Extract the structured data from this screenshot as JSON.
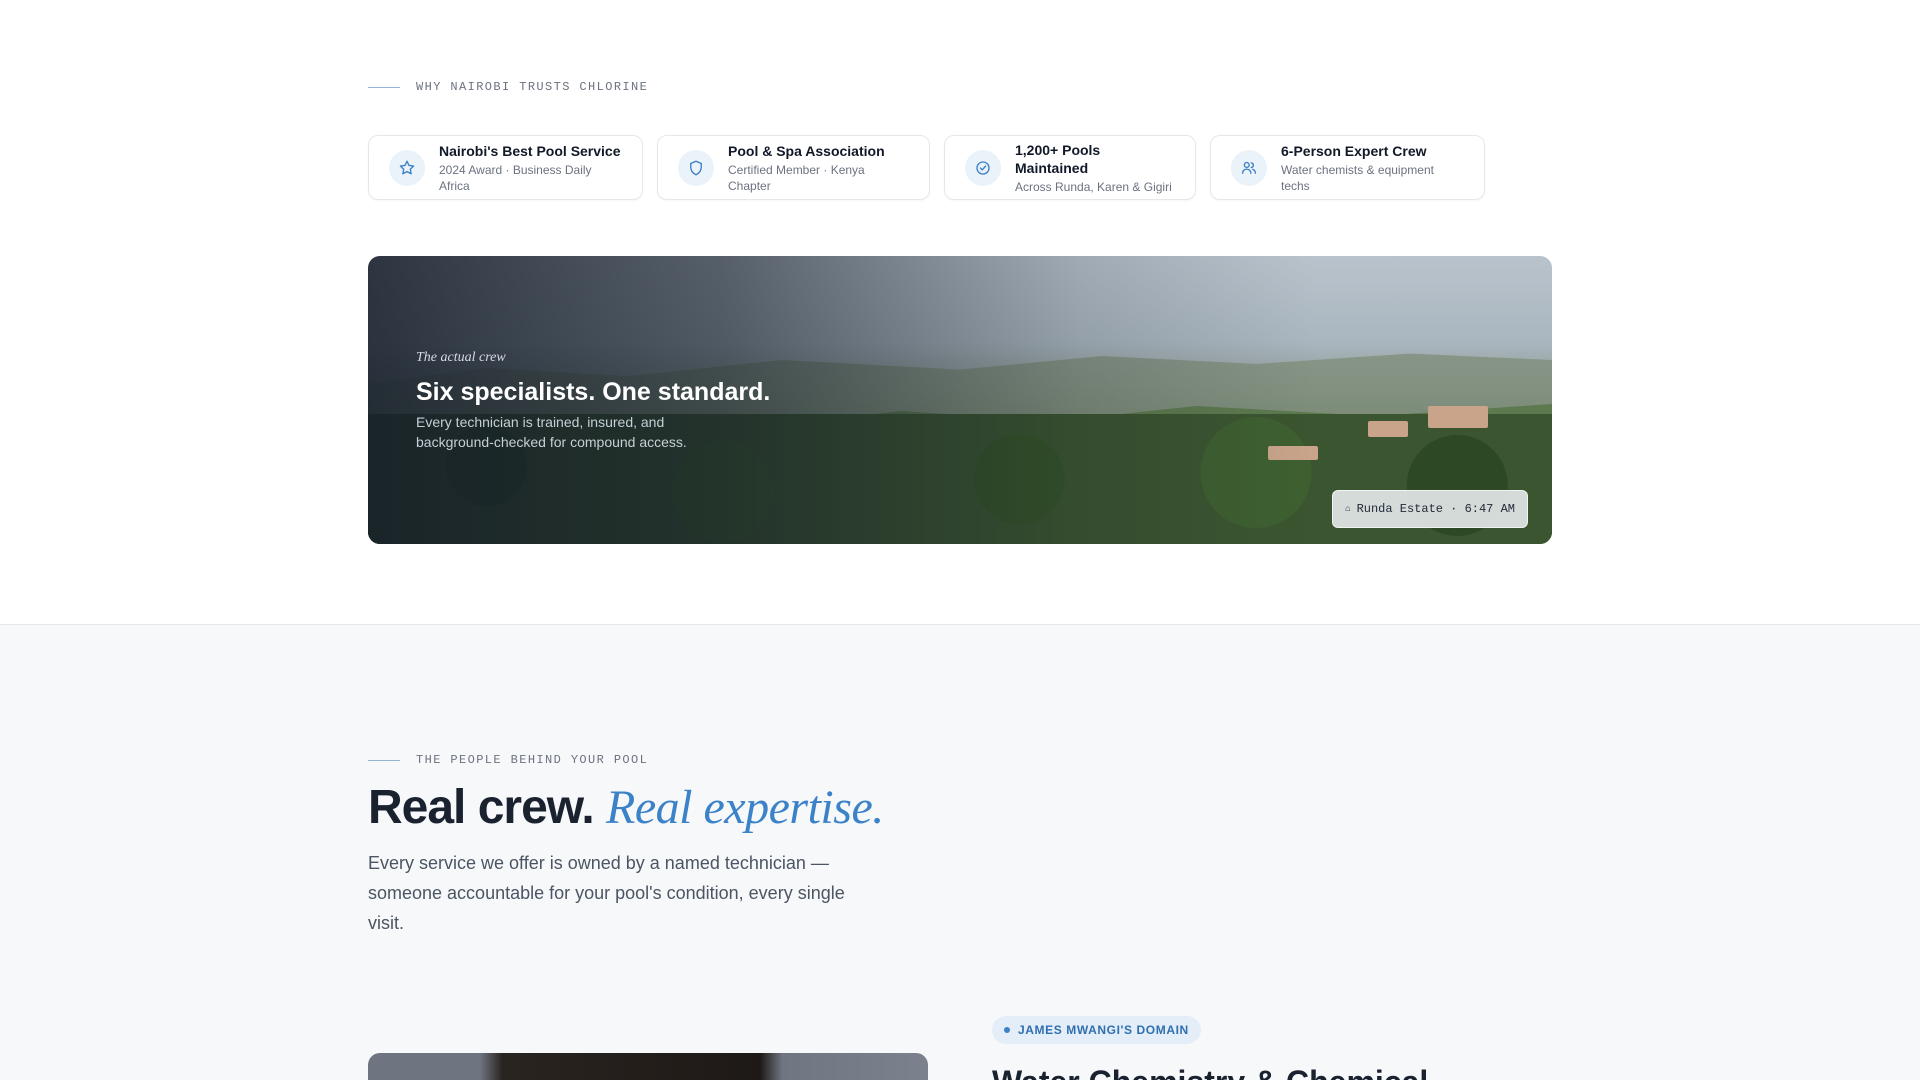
{
  "trust": {
    "eyebrow": "WHY NAIROBI TRUSTS CHLORINE",
    "badges": [
      {
        "title": "Nairobi's Best Pool Service",
        "subtitle": "2024 Award · Business Daily Africa",
        "icon": "star-icon"
      },
      {
        "title": "Pool & Spa Association",
        "subtitle": "Certified Member · Kenya Chapter",
        "icon": "shield-icon"
      },
      {
        "title": "1,200+ Pools Maintained",
        "subtitle": "Across Runda, Karen & Gigiri",
        "icon": "check-circle-icon"
      },
      {
        "title": "6-Person Expert Crew",
        "subtitle": "Water chemists & equipment techs",
        "icon": "users-icon"
      }
    ]
  },
  "hero": {
    "eyebrow": "The actual crew",
    "title": "Six specialists. One standard.",
    "description": "Every technician is trained, insured, and background-checked for compound access.",
    "location_icon": "location-icon",
    "location": "Runda Estate · 6:47 AM"
  },
  "crew": {
    "eyebrow": "THE PEOPLE BEHIND YOUR POOL",
    "title_plain": "Real crew.",
    "title_accent": "Real expertise.",
    "description": "Every service we offer is owned by a named technician — someone accountable for your pool's condition, every single visit.",
    "domain_badge": "JAMES MWANGI'S DOMAIN",
    "next_title": "Water Chemistry & Chemical"
  },
  "colors": {
    "accent": "#3b82c8",
    "ink": "#1a2230",
    "badge_icon_bg": "#eaf2fa"
  }
}
